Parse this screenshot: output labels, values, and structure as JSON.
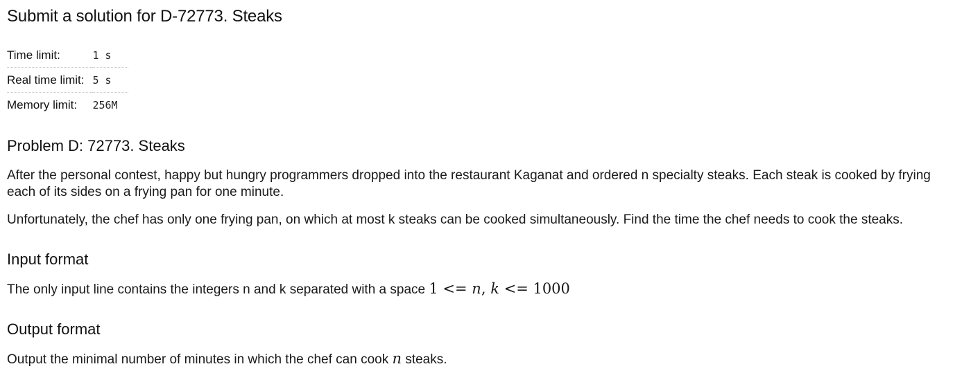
{
  "page": {
    "title": "Submit a solution for D-72773. Steaks"
  },
  "limits": [
    {
      "label": "Time limit:",
      "value": "1 s"
    },
    {
      "label": "Real time limit:",
      "value": "5 s"
    },
    {
      "label": "Memory limit:",
      "value": "256M"
    }
  ],
  "problem": {
    "title": "Problem D: 72773. Steaks",
    "paragraph_1_line_1": "After the personal contest, happy but hungry programmers dropped into the restaurant Kaganat and ordered n specialty steaks. Each steak is cooked by frying",
    "paragraph_1_line_2": "each of its sides on a frying pan for one minute.",
    "paragraph_2": "Unfortunately, the chef has only one frying pan, on which at most k steaks can be cooked simultaneously. Find the time the chef needs to cook the steaks."
  },
  "input_format": {
    "heading": "Input format",
    "text": "The only input line contains the integers n and k separated with a space",
    "math_lhs": "1 <= ",
    "math_n": "n",
    "math_comma": ", ",
    "math_k": "k",
    "math_rhs": " <= 1000"
  },
  "output_format": {
    "heading": "Output format",
    "text_before": "Output the minimal number of minutes in which the chef can cook",
    "math_n": "n",
    "text_after": "steaks."
  }
}
